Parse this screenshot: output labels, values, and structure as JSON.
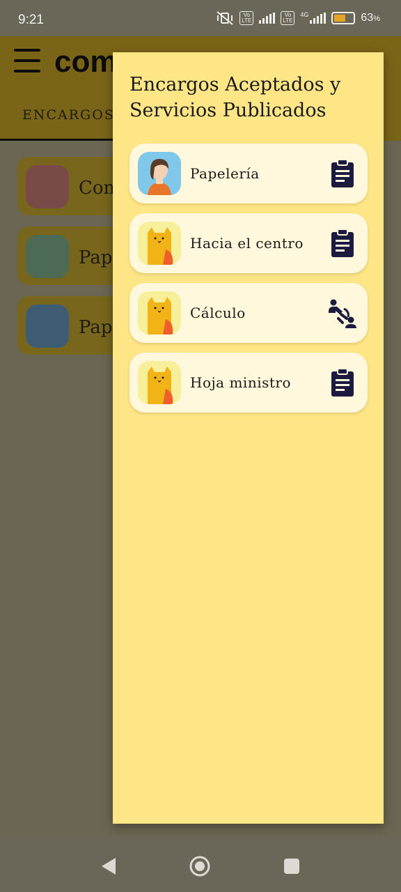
{
  "status_bar": {
    "time": "9:21",
    "battery": "63",
    "battery_unit": "%",
    "network": "4G",
    "volte": "Vo LTE"
  },
  "app_bar": {
    "logo_text": "com",
    "tab_label": "ENCARGOS"
  },
  "background_list": [
    {
      "label": "Com"
    },
    {
      "label": "Pap"
    },
    {
      "label": "Pap"
    }
  ],
  "drawer": {
    "title": "Encargos Aceptados y Servicios Publicados",
    "items": [
      {
        "label": "Papelería",
        "avatar": "girl-avatar",
        "action_icon": "clipboard-icon"
      },
      {
        "label": "Hacia el centro",
        "avatar": "cat-avatar",
        "action_icon": "clipboard-icon"
      },
      {
        "label": "Cálculo",
        "avatar": "cat-avatar",
        "action_icon": "people-handshake-icon"
      },
      {
        "label": "Hoja ministro",
        "avatar": "cat-avatar",
        "action_icon": "clipboard-icon"
      }
    ]
  },
  "colors": {
    "drawer_bg": "#fee585",
    "card_bg": "#fff8dc",
    "icon_dark": "#1c1a3e",
    "scrim": "#6b6653"
  }
}
